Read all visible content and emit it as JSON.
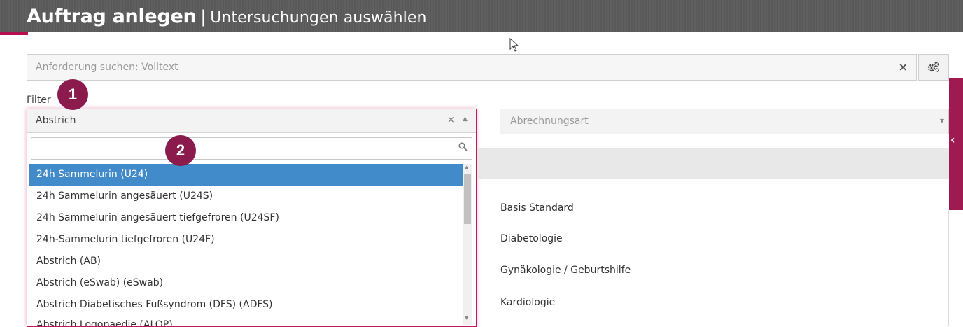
{
  "header": {
    "title": "Auftrag anlegen",
    "separator": "|",
    "subtitle": "Untersuchungen auswählen"
  },
  "search": {
    "placeholder": "Anforderung suchen: Volltext",
    "clear_icon": "×"
  },
  "settings": {
    "icon": "gears-icon",
    "glyph": "⚙"
  },
  "filter": {
    "label": "Filter",
    "selected": "Abstrich",
    "clear": "×",
    "caret": "▲",
    "search_value": "",
    "search_icon": "🔍",
    "options": [
      "24h Sammelurin (U24)",
      "24h Sammelurin angesäuert (U24S)",
      "24h Sammelurin angesäuert tiefgefroren (U24SF)",
      "24h-Sammelurin tiefgefroren (U24F)",
      "Abstrich (AB)",
      "Abstrich (eSwab) (eSwab)",
      "Abstrich Diabetisches Fußsyndrom (DFS) (ADFS)",
      "Abstrich Logopaedie (ALOP)"
    ],
    "active_index": 0
  },
  "badges": [
    "1",
    "2"
  ],
  "billing": {
    "placeholder": "Abrechnungsart",
    "caret": "▼"
  },
  "categories": [
    "Basis Standard",
    "Diabetologie",
    "Gynäkologie / Geburtshilfe",
    "Kardiologie"
  ],
  "side_tab": {
    "arrow": "‹"
  },
  "colors": {
    "accent": "#b5104f",
    "badge": "#8b1a4d",
    "active_option": "#428bca",
    "header_bg": "#5b5b5b"
  }
}
